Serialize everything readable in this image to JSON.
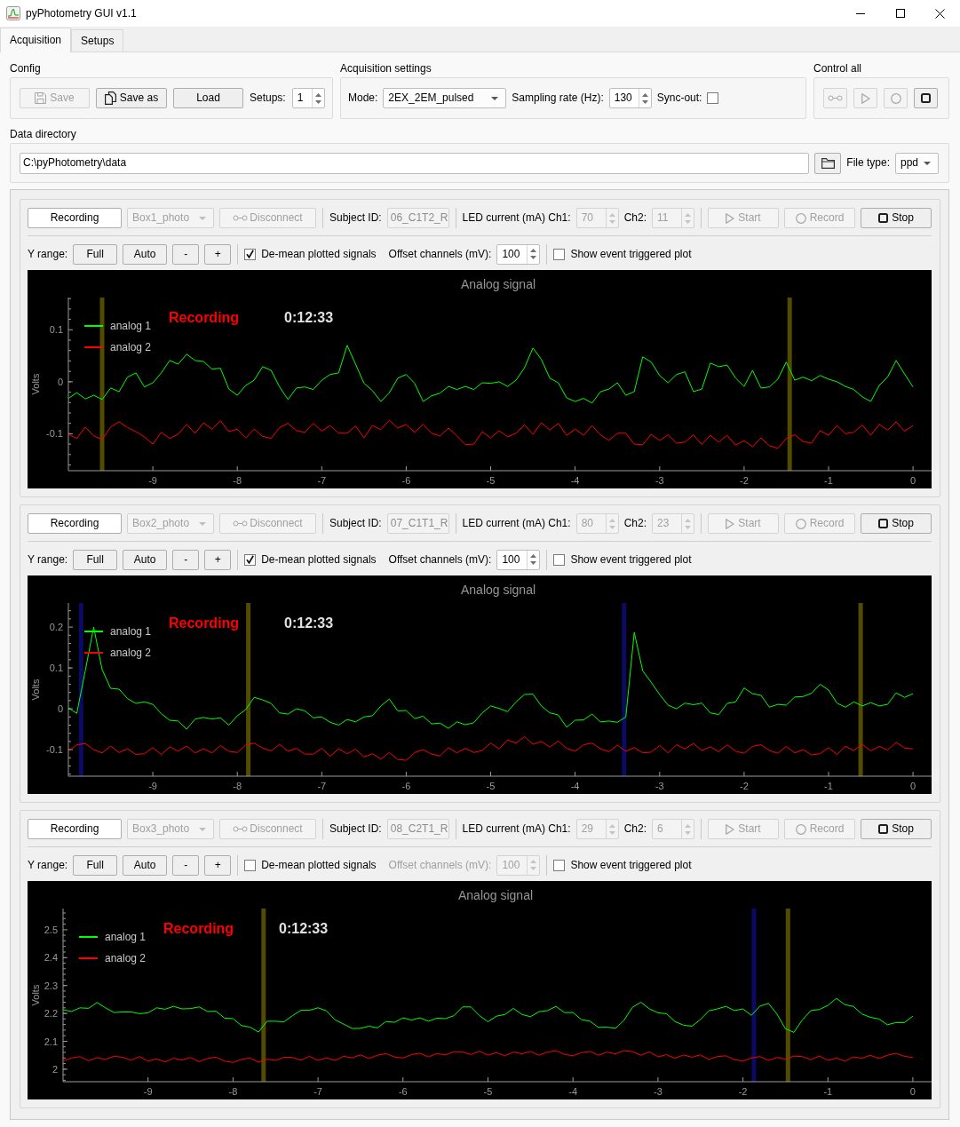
{
  "window": {
    "title": "pyPhotometry GUI v1.1"
  },
  "tabs": [
    {
      "label": "Acquisition",
      "selected": true
    },
    {
      "label": "Setups",
      "selected": false
    }
  ],
  "config": {
    "title": "Config",
    "save": {
      "label": "Save",
      "disabled": true
    },
    "save_as": {
      "label": "Save as",
      "disabled": false
    },
    "load": {
      "label": "Load",
      "disabled": false
    },
    "setups": {
      "label": "Setups:",
      "value": "1"
    }
  },
  "acquisition_settings": {
    "title": "Acquisition settings",
    "mode": {
      "label": "Mode:",
      "value": "2EX_2EM_pulsed"
    },
    "sampling_rate": {
      "label": "Sampling rate (Hz):",
      "value": "130"
    },
    "sync_out": {
      "label": "Sync-out:",
      "checked": false
    }
  },
  "control_all": {
    "title": "Control all",
    "buttons": [
      {
        "kind": "connect",
        "disabled": true
      },
      {
        "kind": "start",
        "disabled": true
      },
      {
        "kind": "record",
        "disabled": true
      },
      {
        "kind": "stop",
        "disabled": false
      }
    ]
  },
  "data_directory": {
    "title": "Data directory",
    "path": "C:\\pyPhotometry\\data",
    "file_type": {
      "label": "File type:",
      "value": "ppd"
    }
  },
  "setups": [
    {
      "status_button": {
        "label": "Recording"
      },
      "port": {
        "value": "Box1_photo",
        "disabled": true
      },
      "disconnect": {
        "label": "Disconnect",
        "disabled": true
      },
      "subject_id": {
        "label": "Subject ID:",
        "value": "06_C1T2_R",
        "disabled": true
      },
      "led_current": {
        "label": "LED current (mA) Ch1:",
        "ch1": "70",
        "ch2_label": "Ch2:",
        "ch2": "11",
        "disabled": true
      },
      "run_buttons": [
        {
          "kind": "start",
          "label": "Start",
          "disabled": true
        },
        {
          "kind": "record",
          "label": "Record",
          "disabled": true
        },
        {
          "kind": "stop",
          "label": "Stop",
          "disabled": false
        }
      ],
      "y_range": {
        "label": "Y range:",
        "buttons": [
          "Full",
          "Auto",
          "-",
          "+"
        ]
      },
      "demean": {
        "label": "De-mean plotted signals",
        "checked": true
      },
      "offset": {
        "label": "Offset channels (mV):",
        "value": "100",
        "disabled": false
      },
      "event_plot": {
        "label": "Show event triggered plot",
        "checked": false
      },
      "plot": {
        "chart_data": {
          "type": "line",
          "title": "Analog signal",
          "ylabel": "Volts",
          "x": [
            -10,
            -9.9,
            -9.8,
            -9.7,
            -9.6,
            -9.5,
            -9.4,
            -9.3,
            -9.2,
            -9.1,
            -9,
            -8.9,
            -8.8,
            -8.7,
            -8.6,
            -8.5,
            -8.4,
            -8.3,
            -8.2,
            -8.1,
            -8,
            -7.9,
            -7.8,
            -7.7,
            -7.6,
            -7.5,
            -7.4,
            -7.3,
            -7.2,
            -7.1,
            -7,
            -6.9,
            -6.8,
            -6.7,
            -6.6,
            -6.5,
            -6.4,
            -6.3,
            -6.2,
            -6.1,
            -6,
            -5.9,
            -5.8,
            -5.7,
            -5.6,
            -5.5,
            -5.4,
            -5.3,
            -5.2,
            -5.1,
            -5,
            -4.9,
            -4.8,
            -4.7,
            -4.6,
            -4.5,
            -4.4,
            -4.3,
            -4.2,
            -4.1,
            -4,
            -3.9,
            -3.8,
            -3.7,
            -3.6,
            -3.5,
            -3.4,
            -3.3,
            -3.2,
            -3.1,
            -3,
            -2.9,
            -2.8,
            -2.7,
            -2.6,
            -2.5,
            -2.4,
            -2.3,
            -2.2,
            -2.1,
            -2,
            -1.9,
            -1.8,
            -1.7,
            -1.6,
            -1.5,
            -1.4,
            -1.3,
            -1.2,
            -1.1,
            -1,
            -0.9,
            -0.8,
            -0.7,
            -0.6,
            -0.5,
            -0.4,
            -0.3,
            -0.2,
            -0.1,
            0
          ],
          "series": [
            {
              "name": "analog 1",
              "color": "#00ff00",
              "values": [
                -0.032,
                -0.021,
                -0.033,
                -0.026,
                -0.034,
                -0.012,
                -0.019,
                0.009,
                0.017,
                -0.01,
                -0.002,
                0.017,
                0.041,
                0.034,
                0.053,
                0.041,
                0.039,
                0.024,
                0.026,
                -0.014,
                -0.026,
                -0.007,
                0.003,
                0.029,
                0.022,
                -0.01,
                -0.034,
                -0.012,
                -0.01,
                -0.015,
                0.003,
                0.014,
                0.017,
                0.07,
                0.034,
                -0.003,
                -0.017,
                -0.038,
                -0.021,
                0.007,
                0.014,
                -0.003,
                -0.038,
                -0.027,
                -0.022,
                -0.009,
                -0.015,
                -0.009,
                -0.015,
                -0.002,
                -0.003,
                0.0,
                -0.009,
                0.003,
                0.027,
                0.065,
                0.043,
                0.007,
                -0.002,
                -0.031,
                -0.038,
                -0.032,
                -0.041,
                -0.019,
                -0.014,
                -0.002,
                -0.026,
                -0.019,
                0.048,
                0.038,
                0.012,
                -0.002,
                0.014,
                0.019,
                -0.019,
                -0.014,
                0.036,
                0.029,
                0.032,
                0.007,
                -0.009,
                0.022,
                -0.012,
                -0.01,
                0.005,
                0.038,
                0.003,
                0.009,
                0.002,
                0.012,
                0.005,
                0.0,
                -0.009,
                -0.015,
                -0.029,
                -0.038,
                -0.007,
                0.009,
                0.041,
                0.015,
                -0.01
              ]
            },
            {
              "name": "analog 2",
              "color": "#ff0000",
              "values": [
                -0.101,
                -0.109,
                -0.087,
                -0.104,
                -0.111,
                -0.087,
                -0.077,
                -0.088,
                -0.096,
                -0.106,
                -0.12,
                -0.097,
                -0.109,
                -0.101,
                -0.082,
                -0.099,
                -0.079,
                -0.091,
                -0.075,
                -0.096,
                -0.091,
                -0.108,
                -0.091,
                -0.105,
                -0.109,
                -0.088,
                -0.08,
                -0.094,
                -0.097,
                -0.08,
                -0.095,
                -0.084,
                -0.099,
                -0.099,
                -0.085,
                -0.108,
                -0.084,
                -0.092,
                -0.074,
                -0.089,
                -0.082,
                -0.097,
                -0.082,
                -0.099,
                -0.104,
                -0.089,
                -0.104,
                -0.121,
                -0.12,
                -0.096,
                -0.108,
                -0.094,
                -0.106,
                -0.099,
                -0.083,
                -0.101,
                -0.079,
                -0.093,
                -0.08,
                -0.103,
                -0.091,
                -0.103,
                -0.084,
                -0.102,
                -0.113,
                -0.099,
                -0.099,
                -0.12,
                -0.121,
                -0.101,
                -0.113,
                -0.102,
                -0.118,
                -0.116,
                -0.102,
                -0.121,
                -0.103,
                -0.116,
                -0.103,
                -0.122,
                -0.113,
                -0.125,
                -0.108,
                -0.123,
                -0.128,
                -0.109,
                -0.102,
                -0.115,
                -0.118,
                -0.094,
                -0.103,
                -0.084,
                -0.1,
                -0.097,
                -0.083,
                -0.103,
                -0.082,
                -0.093,
                -0.077,
                -0.095,
                -0.084
              ]
            }
          ],
          "xlim": [
            -10,
            0.22
          ],
          "ylim": [
            -0.171,
            0.162
          ],
          "xticks": [
            -9,
            -8,
            -7,
            -6,
            -5,
            -4,
            -3,
            -2,
            -1,
            0
          ],
          "yticks": [
            0.1,
            0,
            -0.1
          ],
          "legend": true,
          "ref_lines": [
            {
              "axis": "x",
              "value": -9.6,
              "color": "#524c00"
            },
            {
              "axis": "x",
              "value": -1.46,
              "color": "#524c00"
            }
          ]
        },
        "status": "Recording",
        "time": "0:12:33"
      }
    },
    {
      "status_button": {
        "label": "Recording"
      },
      "port": {
        "value": "Box2_photo",
        "disabled": true
      },
      "disconnect": {
        "label": "Disconnect",
        "disabled": true
      },
      "subject_id": {
        "label": "Subject ID:",
        "value": "07_C1T1_R",
        "disabled": true
      },
      "led_current": {
        "label": "LED current (mA) Ch1:",
        "ch1": "80",
        "ch2_label": "Ch2:",
        "ch2": "23",
        "disabled": true
      },
      "run_buttons": [
        {
          "kind": "start",
          "label": "Start",
          "disabled": true
        },
        {
          "kind": "record",
          "label": "Record",
          "disabled": true
        },
        {
          "kind": "stop",
          "label": "Stop",
          "disabled": false
        }
      ],
      "y_range": {
        "label": "Y range:",
        "buttons": [
          "Full",
          "Auto",
          "-",
          "+"
        ]
      },
      "demean": {
        "label": "De-mean plotted signals",
        "checked": true
      },
      "offset": {
        "label": "Offset channels (mV):",
        "value": "100",
        "disabled": false
      },
      "event_plot": {
        "label": "Show event triggered plot",
        "checked": false
      },
      "plot": {
        "chart_data": {
          "type": "line",
          "title": "Analog signal",
          "ylabel": "Volts",
          "x": [
            -10,
            -9.9,
            -9.8,
            -9.7,
            -9.6,
            -9.5,
            -9.4,
            -9.3,
            -9.2,
            -9.1,
            -9,
            -8.9,
            -8.8,
            -8.7,
            -8.6,
            -8.5,
            -8.4,
            -8.3,
            -8.2,
            -8.1,
            -8,
            -7.9,
            -7.8,
            -7.7,
            -7.6,
            -7.5,
            -7.4,
            -7.3,
            -7.2,
            -7.1,
            -7,
            -6.9,
            -6.8,
            -6.7,
            -6.6,
            -6.5,
            -6.4,
            -6.3,
            -6.2,
            -6.1,
            -6,
            -5.9,
            -5.8,
            -5.7,
            -5.6,
            -5.5,
            -5.4,
            -5.3,
            -5.2,
            -5.1,
            -5,
            -4.9,
            -4.8,
            -4.7,
            -4.6,
            -4.5,
            -4.4,
            -4.3,
            -4.2,
            -4.1,
            -4,
            -3.9,
            -3.8,
            -3.7,
            -3.6,
            -3.5,
            -3.4,
            -3.3,
            -3.2,
            -3.1,
            -3,
            -2.9,
            -2.8,
            -2.7,
            -2.6,
            -2.5,
            -2.4,
            -2.3,
            -2.2,
            -2.1,
            -2,
            -1.9,
            -1.8,
            -1.7,
            -1.6,
            -1.5,
            -1.4,
            -1.3,
            -1.2,
            -1.1,
            -1,
            -0.9,
            -0.8,
            -0.7,
            -0.6,
            -0.5,
            -0.4,
            -0.3,
            -0.2,
            -0.1,
            0
          ],
          "series": [
            {
              "name": "analog 1",
              "color": "#00ff00",
              "values": [
                0.002,
                -0.011,
                0.093,
                0.2,
                0.096,
                0.05,
                0.048,
                0.025,
                0.013,
                0.017,
                0.011,
                -0.012,
                -0.028,
                -0.03,
                -0.05,
                -0.025,
                -0.021,
                -0.025,
                -0.022,
                -0.04,
                -0.017,
                -0.002,
                0.028,
                0.022,
                0.013,
                -0.01,
                -0.013,
                0.0,
                -0.005,
                -0.022,
                -0.02,
                -0.033,
                -0.04,
                -0.026,
                -0.032,
                -0.02,
                -0.017,
                0.007,
                0.024,
                -0.005,
                -0.004,
                -0.024,
                -0.018,
                -0.037,
                -0.035,
                -0.048,
                -0.032,
                -0.039,
                -0.034,
                -0.01,
                0.007,
                0.001,
                -0.007,
                0.017,
                0.035,
                0.036,
                0.007,
                -0.01,
                -0.015,
                -0.045,
                -0.028,
                -0.027,
                -0.013,
                -0.032,
                -0.03,
                -0.033,
                -0.02,
                0.187,
                0.093,
                0.065,
                0.035,
                0.009,
                0.0,
                0.014,
                0.01,
                0.014,
                -0.01,
                -0.014,
                0.013,
                0.017,
                0.051,
                0.037,
                0.033,
                0.004,
                0.011,
                0.009,
                0.029,
                0.03,
                0.038,
                0.06,
                0.046,
                0.014,
                0.004,
                0.017,
                0.007,
                0.015,
                0.007,
                0.011,
                0.039,
                0.028,
                0.037
              ]
            },
            {
              "name": "analog 2",
              "color": "#ff0000",
              "values": [
                -0.104,
                -0.088,
                -0.085,
                -0.1,
                -0.108,
                -0.091,
                -0.107,
                -0.098,
                -0.112,
                -0.11,
                -0.095,
                -0.112,
                -0.093,
                -0.104,
                -0.091,
                -0.108,
                -0.098,
                -0.108,
                -0.09,
                -0.104,
                -0.107,
                -0.089,
                -0.084,
                -0.096,
                -0.103,
                -0.087,
                -0.104,
                -0.097,
                -0.111,
                -0.111,
                -0.097,
                -0.116,
                -0.098,
                -0.11,
                -0.099,
                -0.118,
                -0.11,
                -0.123,
                -0.107,
                -0.124,
                -0.126,
                -0.107,
                -0.1,
                -0.111,
                -0.115,
                -0.095,
                -0.108,
                -0.097,
                -0.107,
                -0.102,
                -0.084,
                -0.098,
                -0.076,
                -0.084,
                -0.068,
                -0.087,
                -0.08,
                -0.094,
                -0.079,
                -0.097,
                -0.104,
                -0.088,
                -0.084,
                -0.098,
                -0.105,
                -0.089,
                -0.104,
                -0.095,
                -0.108,
                -0.106,
                -0.09,
                -0.108,
                -0.088,
                -0.098,
                -0.085,
                -0.102,
                -0.093,
                -0.105,
                -0.088,
                -0.104,
                -0.109,
                -0.092,
                -0.088,
                -0.102,
                -0.109,
                -0.092,
                -0.108,
                -0.1,
                -0.113,
                -0.11,
                -0.095,
                -0.112,
                -0.092,
                -0.102,
                -0.087,
                -0.103,
                -0.092,
                -0.101,
                -0.082,
                -0.096,
                -0.098
              ]
            }
          ],
          "xlim": [
            -10,
            0.22
          ],
          "ylim": [
            -0.165,
            0.259
          ],
          "xticks": [
            -9,
            -8,
            -7,
            -6,
            -5,
            -4,
            -3,
            -2,
            -1,
            0
          ],
          "yticks": [
            0.2,
            0.1,
            0,
            -0.1
          ],
          "legend": true,
          "ref_lines": [
            {
              "axis": "x",
              "value": -9.85,
              "color": "#0b0b63"
            },
            {
              "axis": "x",
              "value": -7.87,
              "color": "#524c00"
            },
            {
              "axis": "x",
              "value": -3.42,
              "color": "#0b0b63"
            },
            {
              "axis": "x",
              "value": -0.62,
              "color": "#524c00"
            }
          ]
        },
        "status": "Recording",
        "time": "0:12:33"
      }
    },
    {
      "status_button": {
        "label": "Recording"
      },
      "port": {
        "value": "Box3_photo",
        "disabled": true
      },
      "disconnect": {
        "label": "Disconnect",
        "disabled": true
      },
      "subject_id": {
        "label": "Subject ID:",
        "value": "08_C2T1_R",
        "disabled": true
      },
      "led_current": {
        "label": "LED current (mA) Ch1:",
        "ch1": "29",
        "ch2_label": "Ch2:",
        "ch2": "6",
        "disabled": true
      },
      "run_buttons": [
        {
          "kind": "start",
          "label": "Start",
          "disabled": true
        },
        {
          "kind": "record",
          "label": "Record",
          "disabled": true
        },
        {
          "kind": "stop",
          "label": "Stop",
          "disabled": false
        }
      ],
      "y_range": {
        "label": "Y range:",
        "buttons": [
          "Full",
          "Auto",
          "-",
          "+"
        ]
      },
      "demean": {
        "label": "De-mean plotted signals",
        "checked": false
      },
      "offset": {
        "label": "Offset channels (mV):",
        "value": "100",
        "disabled": true
      },
      "event_plot": {
        "label": "Show event triggered plot",
        "checked": false
      },
      "plot": {
        "chart_data": {
          "type": "line",
          "title": "Analog signal",
          "ylabel": "Volts",
          "x": [
            -10,
            -9.9,
            -9.8,
            -9.7,
            -9.6,
            -9.5,
            -9.4,
            -9.3,
            -9.2,
            -9.1,
            -9,
            -8.9,
            -8.8,
            -8.7,
            -8.6,
            -8.5,
            -8.4,
            -8.3,
            -8.2,
            -8.1,
            -8,
            -7.9,
            -7.8,
            -7.7,
            -7.6,
            -7.5,
            -7.4,
            -7.3,
            -7.2,
            -7.1,
            -7,
            -6.9,
            -6.8,
            -6.7,
            -6.6,
            -6.5,
            -6.4,
            -6.3,
            -6.2,
            -6.1,
            -6,
            -5.9,
            -5.8,
            -5.7,
            -5.6,
            -5.5,
            -5.4,
            -5.3,
            -5.2,
            -5.1,
            -5,
            -4.9,
            -4.8,
            -4.7,
            -4.6,
            -4.5,
            -4.4,
            -4.3,
            -4.2,
            -4.1,
            -4,
            -3.9,
            -3.8,
            -3.7,
            -3.6,
            -3.5,
            -3.4,
            -3.3,
            -3.2,
            -3.1,
            -3,
            -2.9,
            -2.8,
            -2.7,
            -2.6,
            -2.5,
            -2.4,
            -2.3,
            -2.2,
            -2.1,
            -2,
            -1.9,
            -1.8,
            -1.7,
            -1.6,
            -1.5,
            -1.4,
            -1.3,
            -1.2,
            -1.1,
            -1,
            -0.9,
            -0.8,
            -0.7,
            -0.6,
            -0.5,
            -0.4,
            -0.3,
            -0.2,
            -0.1,
            0
          ],
          "series": [
            {
              "name": "analog 1",
              "color": "#00ff00",
              "values": [
                2.213,
                2.207,
                2.22,
                2.218,
                2.239,
                2.22,
                2.203,
                2.205,
                2.205,
                2.199,
                2.202,
                2.22,
                2.215,
                2.225,
                2.216,
                2.217,
                2.223,
                2.207,
                2.208,
                2.183,
                2.181,
                2.156,
                2.151,
                2.133,
                2.172,
                2.172,
                2.17,
                2.192,
                2.211,
                2.211,
                2.22,
                2.209,
                2.177,
                2.162,
                2.146,
                2.146,
                2.154,
                2.148,
                2.171,
                2.168,
                2.184,
                2.176,
                2.184,
                2.172,
                2.183,
                2.181,
                2.192,
                2.223,
                2.223,
                2.192,
                2.17,
                2.19,
                2.196,
                2.218,
                2.196,
                2.188,
                2.206,
                2.21,
                2.225,
                2.203,
                2.203,
                2.178,
                2.172,
                2.15,
                2.151,
                2.146,
                2.175,
                2.222,
                2.24,
                2.216,
                2.202,
                2.199,
                2.171,
                2.158,
                2.154,
                2.178,
                2.209,
                2.216,
                2.225,
                2.21,
                2.216,
                2.193,
                2.226,
                2.236,
                2.198,
                2.145,
                2.132,
                2.177,
                2.21,
                2.214,
                2.229,
                2.254,
                2.231,
                2.225,
                2.198,
                2.186,
                2.18,
                2.159,
                2.167,
                2.167,
                2.19
              ]
            },
            {
              "name": "analog 2",
              "color": "#ff0000",
              "values": [
                2.029,
                2.04,
                2.045,
                2.03,
                2.041,
                2.035,
                2.046,
                2.043,
                2.032,
                2.045,
                2.029,
                2.037,
                2.026,
                2.039,
                2.033,
                2.042,
                2.027,
                2.038,
                2.043,
                2.029,
                2.024,
                2.035,
                2.04,
                2.025,
                2.036,
                2.031,
                2.043,
                2.042,
                2.032,
                2.046,
                2.031,
                2.041,
                2.031,
                2.046,
                2.041,
                2.051,
                2.038,
                2.05,
                2.056,
                2.044,
                2.04,
                2.052,
                2.057,
                2.044,
                2.056,
                2.051,
                2.063,
                2.062,
                2.052,
                2.065,
                2.05,
                2.059,
                2.048,
                2.061,
                2.055,
                2.064,
                2.05,
                2.061,
                2.066,
                2.053,
                2.048,
                2.059,
                2.064,
                2.05,
                2.061,
                2.055,
                2.066,
                2.063,
                2.05,
                2.062,
                2.044,
                2.052,
                2.039,
                2.051,
                2.043,
                2.051,
                2.035,
                2.045,
                2.048,
                2.034,
                2.029,
                2.04,
                2.045,
                2.031,
                2.042,
                2.036,
                2.047,
                2.045,
                2.034,
                2.047,
                2.031,
                2.04,
                2.029,
                2.044,
                2.039,
                2.05,
                2.038,
                2.05,
                2.057,
                2.046,
                2.042
              ]
            }
          ],
          "xlim": [
            -10,
            0.22
          ],
          "ylim": [
            1.955,
            2.576
          ],
          "xticks": [
            -9,
            -8,
            -7,
            -6,
            -5,
            -4,
            -3,
            -2,
            -1,
            0
          ],
          "yticks": [
            2.5,
            2.4,
            2.3,
            2.2,
            2.1,
            2
          ],
          "legend": true,
          "ref_lines": [
            {
              "axis": "x",
              "value": -7.64,
              "color": "#524c00"
            },
            {
              "axis": "x",
              "value": -1.87,
              "color": "#0b0b63"
            },
            {
              "axis": "x",
              "value": -1.47,
              "color": "#524c00"
            }
          ]
        },
        "status": "Recording",
        "time": "0:12:33"
      }
    }
  ]
}
